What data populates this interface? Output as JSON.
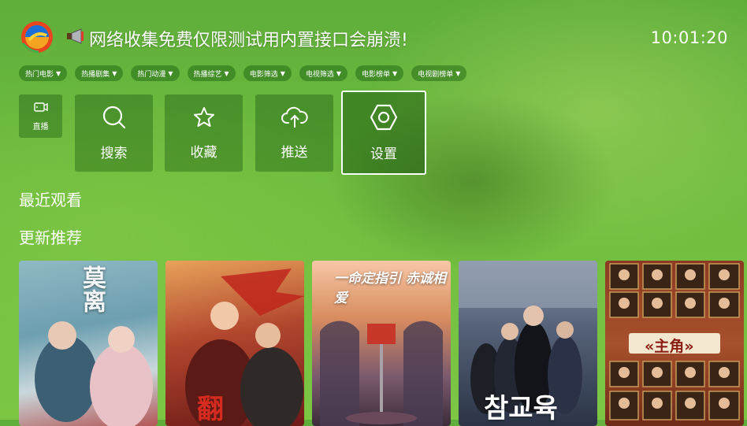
{
  "header": {
    "notice_text": "网络收集免费仅限测试用内置接口会崩溃!",
    "clock": "10:01:20",
    "logo_icon": "app-logo",
    "notice_icon": "megaphone-icon"
  },
  "filters": [
    {
      "label": "热门电影"
    },
    {
      "label": "热播剧集"
    },
    {
      "label": "热门动漫"
    },
    {
      "label": "热播综艺"
    },
    {
      "label": "电影筛选"
    },
    {
      "label": "电视筛选"
    },
    {
      "label": "电影榜单"
    },
    {
      "label": "电视剧榜单"
    }
  ],
  "filter_caret": "▼",
  "quick_actions": {
    "live": {
      "label": "直播",
      "icon": "tv-icon"
    },
    "search": {
      "label": "搜索",
      "icon": "search-icon"
    },
    "favorites": {
      "label": "收藏",
      "icon": "star-icon"
    },
    "push": {
      "label": "推送",
      "icon": "cloud-upload-icon"
    },
    "settings": {
      "label": "设置",
      "icon": "gear-icon"
    }
  },
  "sections": {
    "recent": "最近观看",
    "updates": "更新推荐"
  },
  "posters": [
    {
      "title": "莫离"
    },
    {
      "title": ""
    },
    {
      "title": "一命定指引 赤诚相爱"
    },
    {
      "title": "참교육"
    },
    {
      "title": "«主角»"
    }
  ],
  "colors": {
    "background": "#6fbd3f",
    "tile": "rgba(0,60,0,0.3)",
    "focus_border": "#ffffff"
  }
}
